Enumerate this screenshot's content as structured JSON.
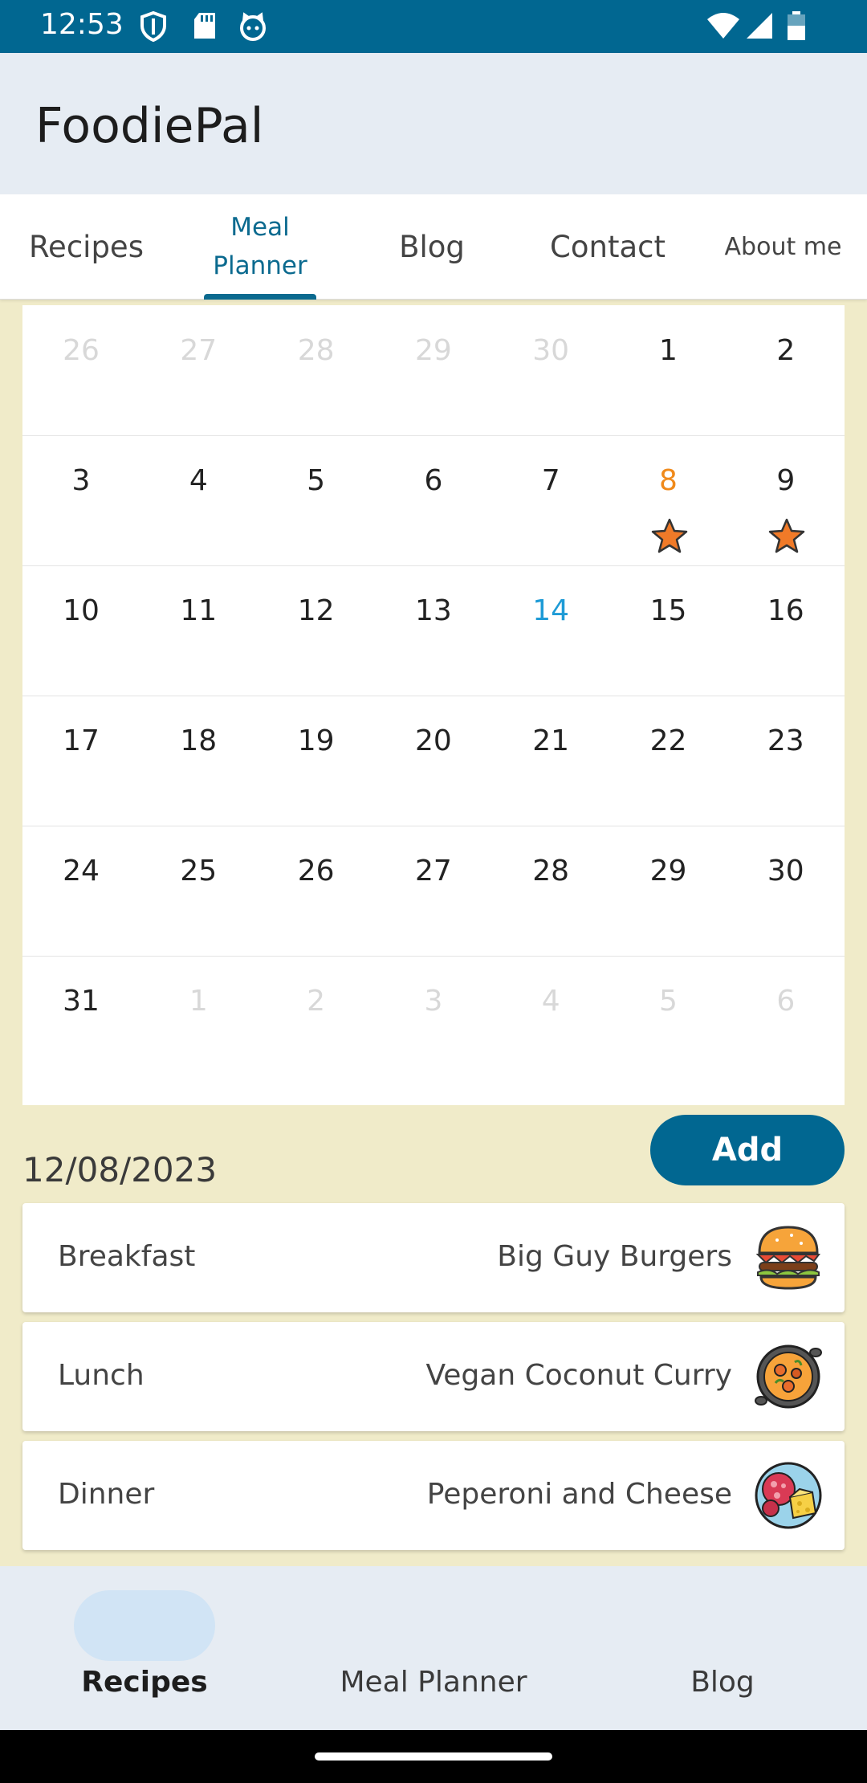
{
  "status_bar": {
    "time": "12:53"
  },
  "app": {
    "title": "FoodiePal"
  },
  "tabs": [
    {
      "label": "Recipes"
    },
    {
      "label": "Meal\nPlanner"
    },
    {
      "label": "Blog"
    },
    {
      "label": "Contact"
    },
    {
      "label": "About me"
    }
  ],
  "calendar": {
    "weeks": [
      [
        {
          "d": "26",
          "s": "dim"
        },
        {
          "d": "27",
          "s": "dim"
        },
        {
          "d": "28",
          "s": "dim"
        },
        {
          "d": "29",
          "s": "dim"
        },
        {
          "d": "30",
          "s": "dim"
        },
        {
          "d": "1",
          "s": ""
        },
        {
          "d": "2",
          "s": ""
        }
      ],
      [
        {
          "d": "3",
          "s": ""
        },
        {
          "d": "4",
          "s": ""
        },
        {
          "d": "5",
          "s": ""
        },
        {
          "d": "6",
          "s": ""
        },
        {
          "d": "7",
          "s": ""
        },
        {
          "d": "8",
          "s": "sel",
          "star": true
        },
        {
          "d": "9",
          "s": "",
          "star": true
        }
      ],
      [
        {
          "d": "10",
          "s": ""
        },
        {
          "d": "11",
          "s": ""
        },
        {
          "d": "12",
          "s": ""
        },
        {
          "d": "13",
          "s": ""
        },
        {
          "d": "14",
          "s": "today"
        },
        {
          "d": "15",
          "s": ""
        },
        {
          "d": "16",
          "s": ""
        }
      ],
      [
        {
          "d": "17",
          "s": ""
        },
        {
          "d": "18",
          "s": ""
        },
        {
          "d": "19",
          "s": ""
        },
        {
          "d": "20",
          "s": ""
        },
        {
          "d": "21",
          "s": ""
        },
        {
          "d": "22",
          "s": ""
        },
        {
          "d": "23",
          "s": ""
        }
      ],
      [
        {
          "d": "24",
          "s": ""
        },
        {
          "d": "25",
          "s": ""
        },
        {
          "d": "26",
          "s": ""
        },
        {
          "d": "27",
          "s": ""
        },
        {
          "d": "28",
          "s": ""
        },
        {
          "d": "29",
          "s": ""
        },
        {
          "d": "30",
          "s": ""
        }
      ],
      [
        {
          "d": "31",
          "s": ""
        },
        {
          "d": "1",
          "s": "dim"
        },
        {
          "d": "2",
          "s": "dim"
        },
        {
          "d": "3",
          "s": "dim"
        },
        {
          "d": "4",
          "s": "dim"
        },
        {
          "d": "5",
          "s": "dim"
        },
        {
          "d": "6",
          "s": "dim"
        }
      ]
    ],
    "colors": {
      "selected": "#f08a1b",
      "today": "#1e9bd6",
      "star": "#f07a28"
    }
  },
  "planner": {
    "selected_date": "12/08/2023",
    "add_label": "Add",
    "meals": [
      {
        "type": "Breakfast",
        "recipe": "Big Guy Burgers",
        "icon": "burger-icon"
      },
      {
        "type": "Lunch",
        "recipe": "Vegan Coconut Curry",
        "icon": "curry-icon"
      },
      {
        "type": "Dinner",
        "recipe": "Peperoni and Cheese",
        "icon": "pepperoni-cheese-icon"
      }
    ]
  },
  "bottom_nav": [
    {
      "label": "Recipes"
    },
    {
      "label": "Meal Planner"
    },
    {
      "label": "Blog"
    }
  ],
  "theme": {
    "primary": "#016791",
    "background": "#f0ebc9",
    "appbar": "#e6ecf3"
  }
}
